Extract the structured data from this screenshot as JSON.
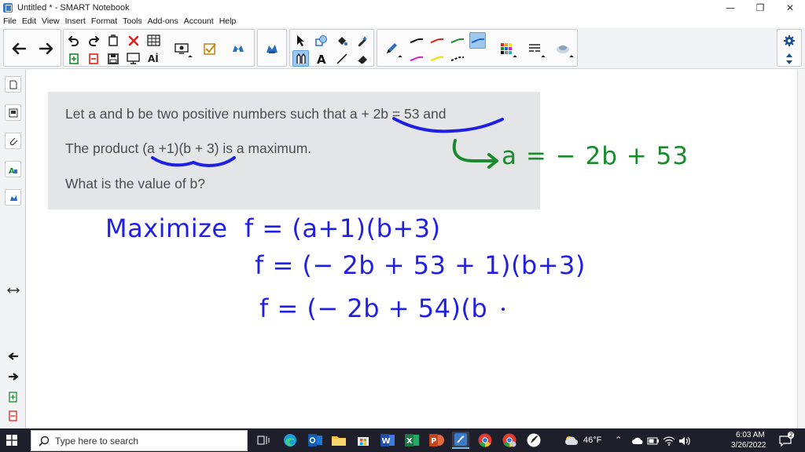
{
  "window": {
    "title": "Untitled * - SMART Notebook",
    "controls": [
      "—",
      "❐",
      "✕"
    ]
  },
  "menu": [
    "File",
    "Edit",
    "View",
    "Insert",
    "Format",
    "Tools",
    "Add-ons",
    "Account",
    "Help"
  ],
  "colors": {
    "ink_blue": "#1f1fe6",
    "ink_green": "#1a8a2c",
    "toolbar_bg": "#f2f3f5",
    "problem_bg": "#e3e5e6",
    "taskbar_bg": "#1f1f2b",
    "active_pen": "#9ec9ef"
  },
  "toolbar": {
    "icons": [
      "back-arrow-icon",
      "forward-arrow-icon",
      "undo-icon",
      "redo-icon",
      "new-page-icon",
      "delete-icon",
      "table-icon",
      "screen-shade-icon",
      "add-on-icon",
      "check-icon",
      "activity-icon",
      "select-icon",
      "shapes-icon",
      "fill-icon",
      "text-icon",
      "line-icon",
      "eraser-icon",
      "pen-icon",
      "magic-pen-icon",
      "settings-icon"
    ],
    "pen_colors": [
      "#111111",
      "#e0201b",
      "#1a8a2c",
      "#1f5fd0",
      "#d21fc8",
      "#f2e21c",
      "#111111"
    ],
    "active_pen_index": 3
  },
  "problem": {
    "line1": "Let a and b be two positive numbers such that a + 2b = 53 and",
    "line2": "The product (a +1)(b + 3) is a maximum.",
    "line3": "What is the value of b?"
  },
  "handwriting": {
    "substitution": "a = − 2b + 53",
    "line1": "Maximize  f = (a+1)(b+3)",
    "line2": "f = (− 2b + 53 + 1)(b+3)",
    "line3": "f = (− 2b + 54)(b"
  },
  "taskbar": {
    "search_placeholder": "Type here to search",
    "weather": "46°F",
    "time": "6:03 AM",
    "date": "3/26/2022",
    "notifications": "2"
  }
}
